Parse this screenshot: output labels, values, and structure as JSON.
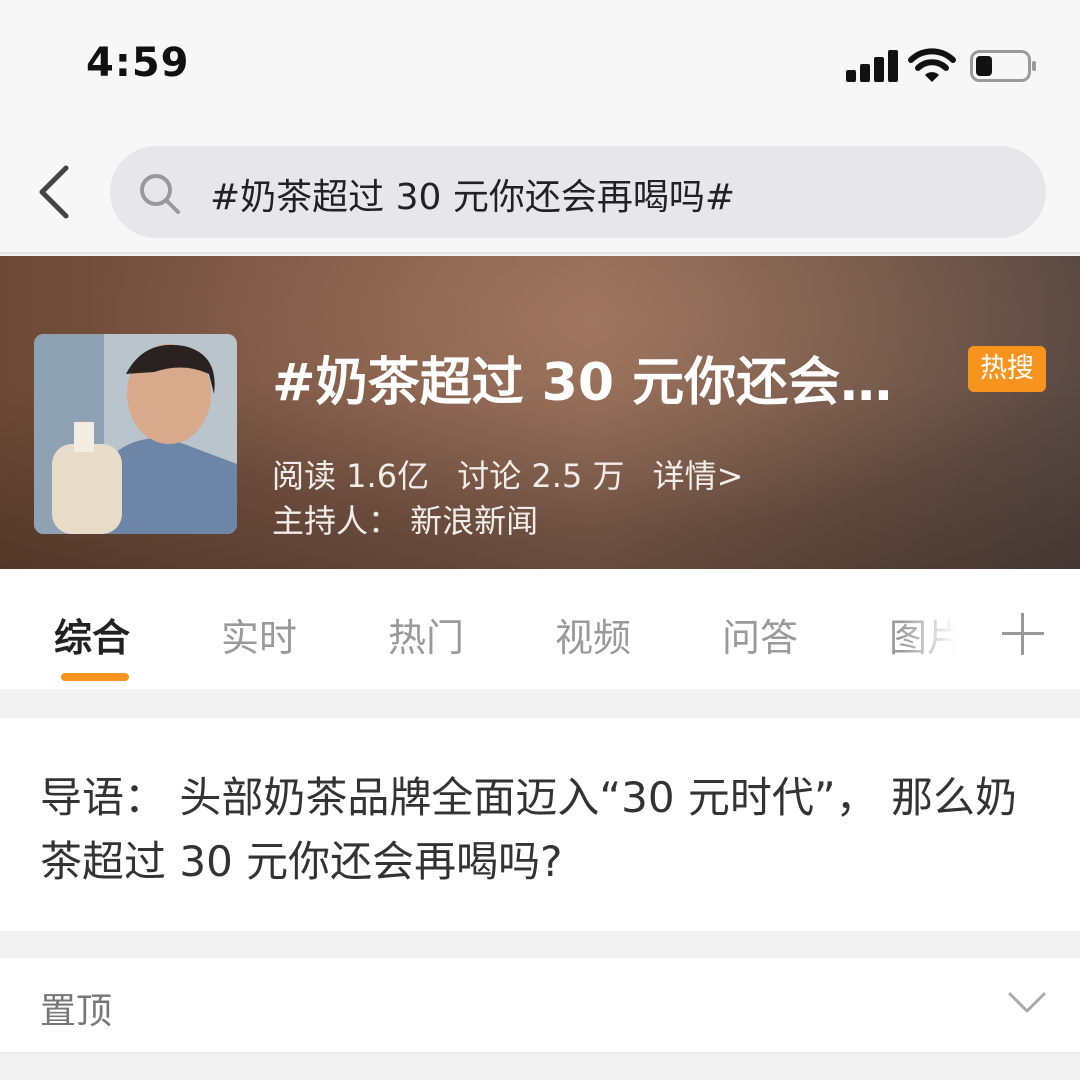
{
  "status_bar": {
    "time": "4:59",
    "icons": [
      "cellular-signal-icon",
      "wifi-icon",
      "battery-icon"
    ]
  },
  "search": {
    "query": "#奶茶超过 30 元你还会再喝吗#",
    "icons": [
      "back-arrow-icon",
      "search-icon"
    ]
  },
  "topic": {
    "title": "#奶茶超过 30 元你还会…",
    "badge": "热搜",
    "reads": "阅读 1.6亿",
    "discussions": "讨论 2.5 万",
    "details_link": "详情>",
    "host": "主持人：  新浪新闻"
  },
  "tabs": {
    "items": [
      {
        "label": "综合",
        "active": true
      },
      {
        "label": "实时"
      },
      {
        "label": "热门"
      },
      {
        "label": "视频"
      },
      {
        "label": "问答"
      },
      {
        "label": "图片"
      }
    ],
    "add_icon": "plus-icon"
  },
  "intro": {
    "text": "导语：  头部奶茶品牌全面迈入“30 元时代”， 那么奶茶超过 30 元你还会再喝吗?"
  },
  "pinned": {
    "label": "置顶",
    "icon": "chevron-down-icon"
  },
  "colors": {
    "accent": "#f8941d",
    "banner_bg": "#7d5846"
  }
}
